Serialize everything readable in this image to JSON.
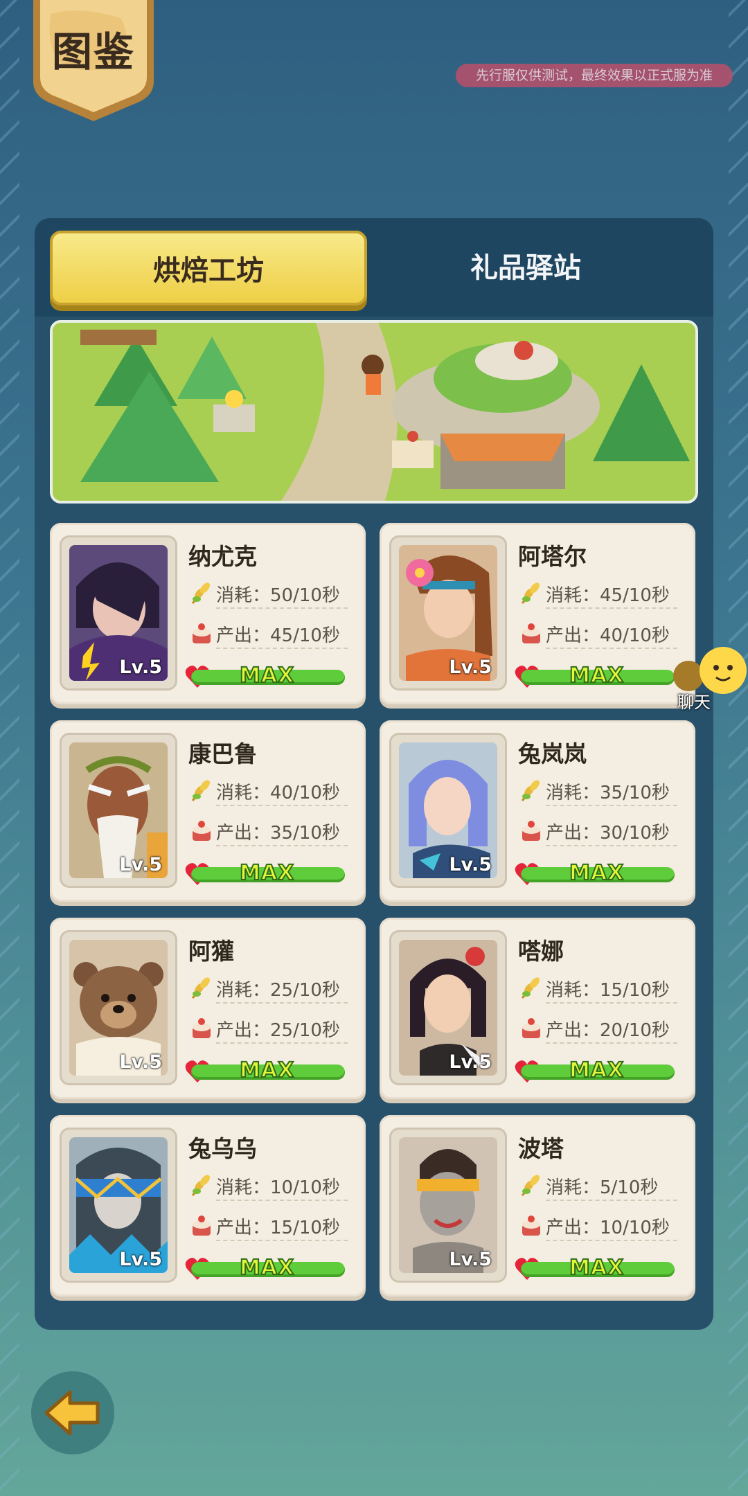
{
  "header": {
    "title": "图鉴",
    "test_notice": "先行服仅供测试，最终效果以正式服为准"
  },
  "tabs": [
    {
      "label": "烘焙工坊",
      "active": true
    },
    {
      "label": "礼品驿站",
      "active": false
    }
  ],
  "cards": [
    {
      "name": "纳尤克",
      "consume": "消耗：50/10秒",
      "produce": "产出：45/10秒",
      "level": "Lv.5",
      "status": "MAX"
    },
    {
      "name": "阿塔尔",
      "consume": "消耗：45/10秒",
      "produce": "产出：40/10秒",
      "level": "Lv.5",
      "status": "MAX"
    },
    {
      "name": "康巴鲁",
      "consume": "消耗：40/10秒",
      "produce": "产出：35/10秒",
      "level": "Lv.5",
      "status": "MAX"
    },
    {
      "name": "兔岚岚",
      "consume": "消耗：35/10秒",
      "produce": "产出：30/10秒",
      "level": "Lv.5",
      "status": "MAX"
    },
    {
      "name": "阿獾",
      "consume": "消耗：25/10秒",
      "produce": "产出：25/10秒",
      "level": "Lv.5",
      "status": "MAX"
    },
    {
      "name": "嗒娜",
      "consume": "消耗：15/10秒",
      "produce": "产出：20/10秒",
      "level": "Lv.5",
      "status": "MAX"
    },
    {
      "name": "兔乌乌",
      "consume": "消耗：10/10秒",
      "produce": "产出：15/10秒",
      "level": "Lv.5",
      "status": "MAX"
    },
    {
      "name": "波塔",
      "consume": "消耗：5/10秒",
      "produce": "产出：10/10秒",
      "level": "Lv.5",
      "status": "MAX"
    }
  ],
  "chat": {
    "label": "聊天"
  },
  "icons": {
    "consume": "wheat-icon",
    "produce": "cake-icon",
    "affection": "heart-icon",
    "back": "back-arrow-icon"
  }
}
